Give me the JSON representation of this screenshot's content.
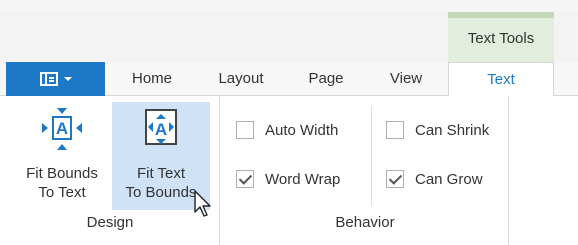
{
  "contextual_group": {
    "label": "Text Tools",
    "color": "#e3eddd"
  },
  "file_button": {
    "icon": "ribbon-menu-icon",
    "color": "#1e78c8"
  },
  "tabs": [
    {
      "label": "Home",
      "active": false
    },
    {
      "label": "Layout",
      "active": false
    },
    {
      "label": "Page",
      "active": false
    },
    {
      "label": "View",
      "active": false
    },
    {
      "label": "Text",
      "active": true
    }
  ],
  "groups": {
    "design": {
      "label": "Design",
      "buttons": [
        {
          "line1": "Fit Bounds",
          "line2": "To Text",
          "icon": "fit-bounds-to-text-icon",
          "hovered": false
        },
        {
          "line1": "Fit Text",
          "line2": "To Bounds",
          "icon": "fit-text-to-bounds-icon",
          "hovered": true
        }
      ]
    },
    "behavior": {
      "label": "Behavior",
      "checks": [
        {
          "label": "Auto Width",
          "checked": false
        },
        {
          "label": "Word Wrap",
          "checked": true
        },
        {
          "label": "Can Shrink",
          "checked": false
        },
        {
          "label": "Can Grow",
          "checked": true
        }
      ]
    }
  },
  "accent_color": "#1e78c8",
  "hover_color": "#cfe2f6"
}
